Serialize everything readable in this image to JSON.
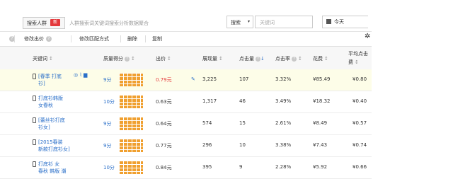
{
  "topbar": {
    "search_tab": "搜索人群",
    "new_badge": "新",
    "search_desc": "人群搜索词关键词搜索分析数据聚合",
    "match_select": "搜索",
    "keyword_placeholder": "关键词",
    "date_select": "今天"
  },
  "toolbar": {
    "modify_bid": "修改出价",
    "modify_match": "修改匹配方式",
    "delete": "删除",
    "copy": "复制"
  },
  "columns": {
    "keyword": "关键词",
    "quality": "质量得分",
    "bid": "出价",
    "impressions": "展现量",
    "clicks": "点击量",
    "ctr": "点击率",
    "cost": "花费",
    "avg_cpc_line1": "平均点击",
    "avg_cpc_line2": "费"
  },
  "rows": [
    {
      "kw1": "[春季 打底",
      "kw2": "衫]",
      "score": "9分",
      "bid": "0.79元",
      "imp": "3,225",
      "clk": "107",
      "ctr": "3.32%",
      "cost": "¥85.49",
      "avg": "¥0.80",
      "highlight": true
    },
    {
      "kw1": "打底衫韩版",
      "kw2": "女春秋",
      "score": "10分",
      "bid": "0.63元",
      "imp": "1,317",
      "clk": "46",
      "ctr": "3.49%",
      "cost": "¥18.32",
      "avg": "¥0.40",
      "highlight": false
    },
    {
      "kw1": "[蕾丝衫打底",
      "kw2": "衫女]",
      "score": "9分",
      "bid": "0.64元",
      "imp": "574",
      "clk": "15",
      "ctr": "2.61%",
      "cost": "¥8.49",
      "avg": "¥0.57",
      "highlight": false
    },
    {
      "kw1": "[2015春装",
      "kw2": "新款打底衫女]",
      "score": "9分",
      "bid": "0.77元",
      "imp": "296",
      "clk": "10",
      "ctr": "3.38%",
      "cost": "¥7.43",
      "avg": "¥0.74",
      "highlight": false
    },
    {
      "kw1": "打底衫 女",
      "kw2": "春秋 韩版 潮",
      "score": "10分",
      "bid": "0.84元",
      "imp": "395",
      "clk": "9",
      "ctr": "2.28%",
      "cost": "¥5.92",
      "avg": "¥0.66",
      "highlight": false
    }
  ]
}
